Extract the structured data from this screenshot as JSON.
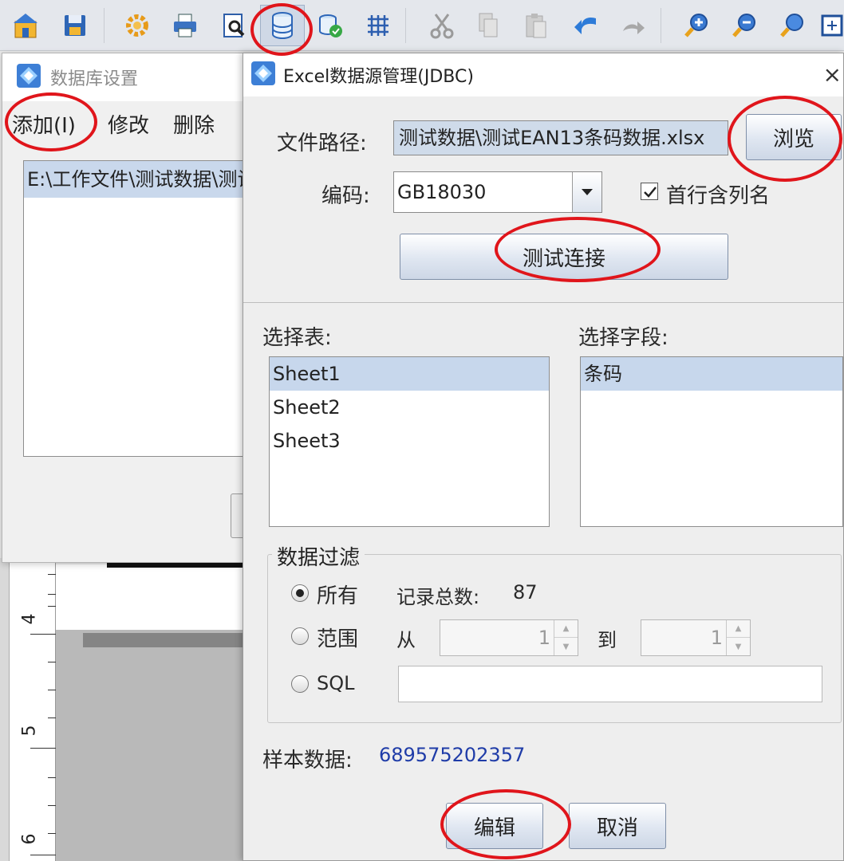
{
  "toolbar": {
    "icons": [
      "home-icon",
      "save-icon",
      "settings-icon",
      "print-icon",
      "print-preview-icon",
      "database-icon",
      "database-link-icon",
      "grid-icon",
      "cut-icon",
      "copy-icon",
      "paste-icon",
      "undo-icon",
      "redo-icon",
      "zoom-in-icon",
      "zoom-out-icon",
      "zoom-icon",
      "fit-icon"
    ],
    "active_icon": "database-icon"
  },
  "ruler": {
    "marks": [
      "4",
      "5",
      "6"
    ]
  },
  "db_window": {
    "title": "数据库设置",
    "menu": {
      "add": "添加(I)",
      "modify": "修改",
      "delete": "删除"
    },
    "list": [
      "E:\\工作文件\\测试数据\\测试EAN13条码数据.xlsx"
    ]
  },
  "excel_dialog": {
    "title": "Excel数据源管理(JDBC)",
    "close_glyph": "×",
    "file_path": {
      "label": "文件路径:",
      "value": "测试数据\\测试EAN13条码数据.xlsx"
    },
    "browse_label": "浏览",
    "encoding": {
      "label": "编码:",
      "value": "GB18030"
    },
    "first_row_header": {
      "label": "首行含列名",
      "checked": true
    },
    "test_connection_label": "测试连接",
    "select_table": {
      "label": "选择表:",
      "items": [
        "Sheet1",
        "Sheet2",
        "Sheet3"
      ],
      "selected": "Sheet1"
    },
    "select_field": {
      "label": "选择字段:",
      "items": [
        "条码"
      ],
      "selected": "条码"
    },
    "filter": {
      "legend": "数据过滤",
      "all_label": "所有",
      "record_total_label": "记录总数:",
      "record_total_value": "87",
      "range_label": "范围",
      "from_label": "从",
      "from_value": "1",
      "to_label": "到",
      "to_value": "1",
      "sql_label": "SQL",
      "sql_value": "",
      "selected_option": "all"
    },
    "sample": {
      "label": "样本数据:",
      "value": "689575202357"
    },
    "edit_label": "编辑",
    "cancel_label": "取消"
  },
  "colors": {
    "highlight_circle": "#e0151b",
    "selection": "#c7d7ec",
    "sample_value": "#1f3ca8"
  }
}
